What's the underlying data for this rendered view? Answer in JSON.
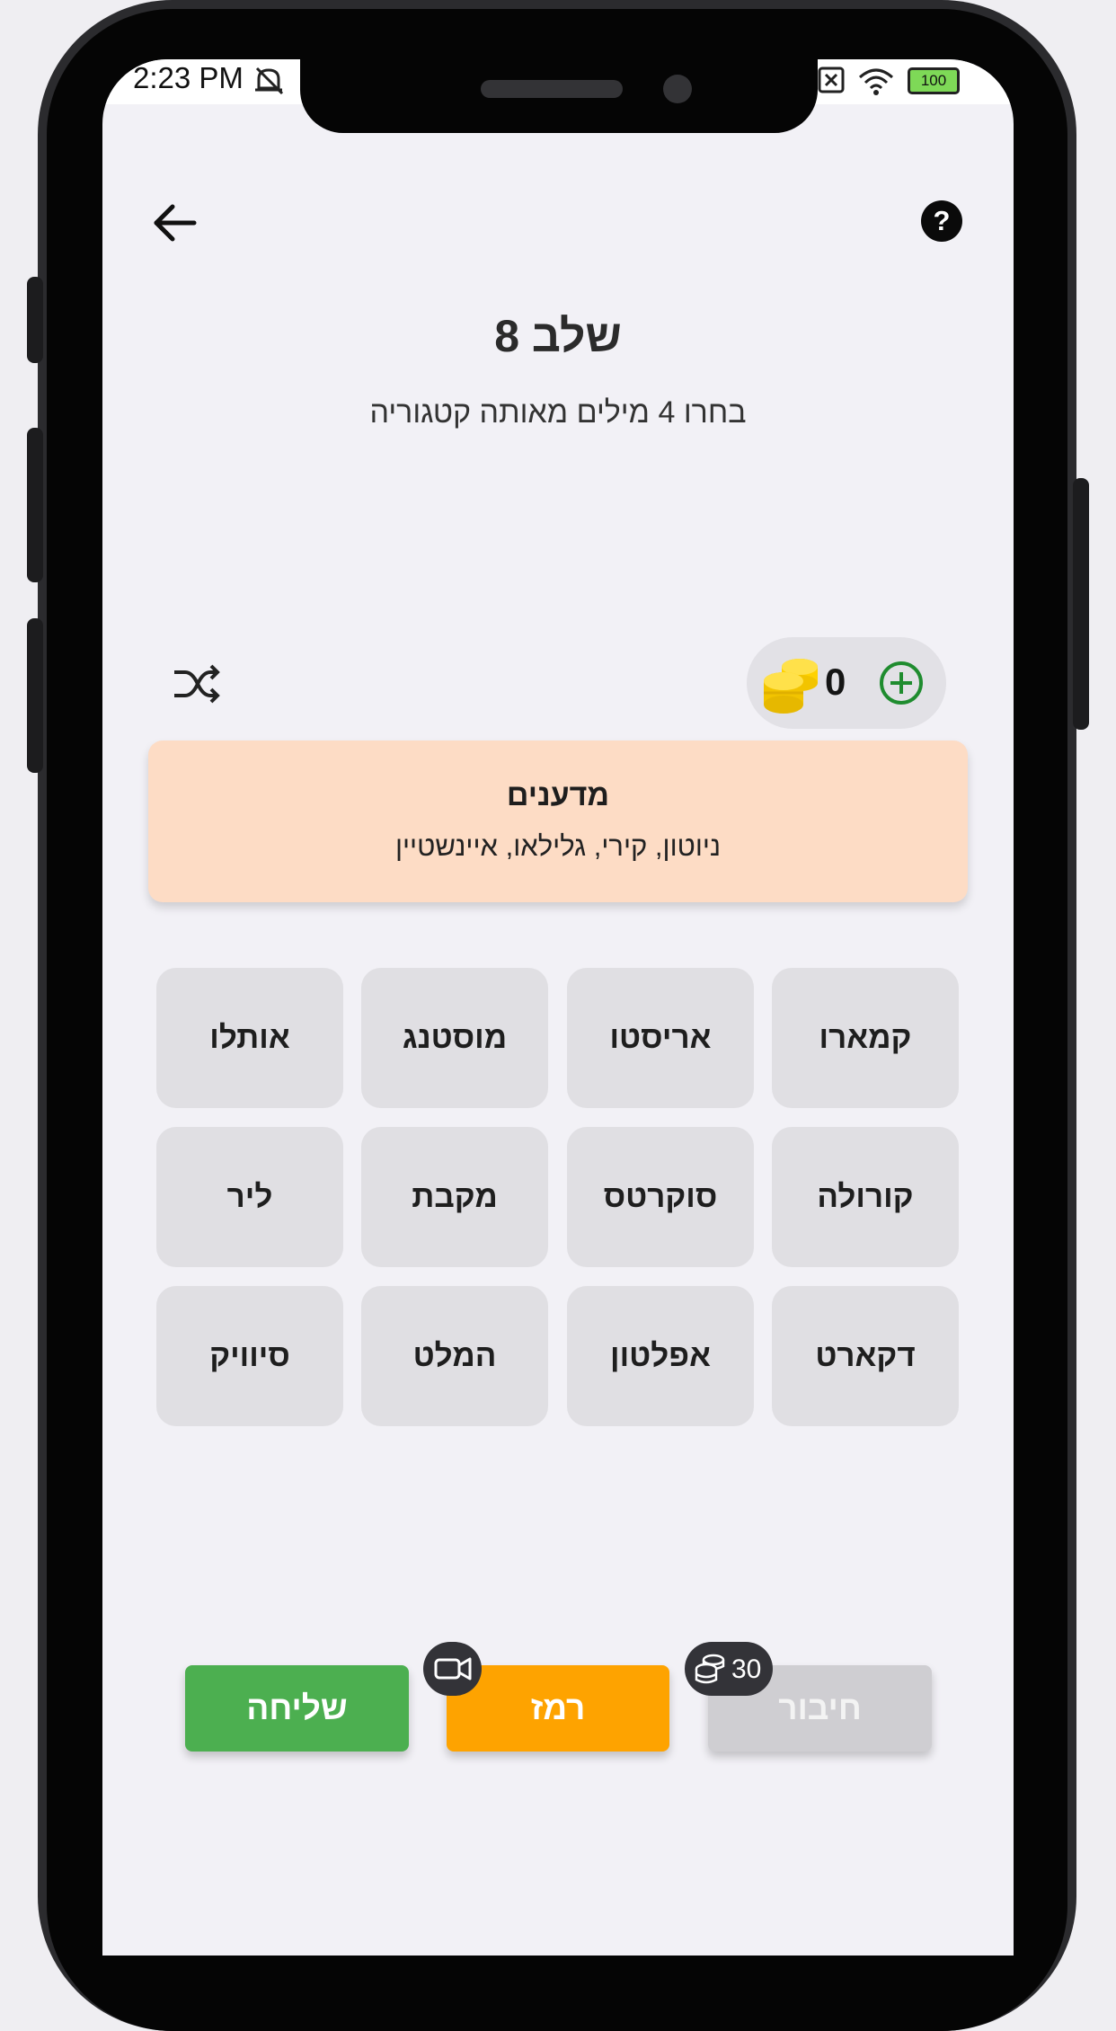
{
  "status_bar": {
    "time": "2:23 PM",
    "battery": "100"
  },
  "header": {
    "back_icon": "arrow-left-icon",
    "help_label": "?",
    "title": "שלב 8",
    "subtitle": "בחרו 4 מילים מאותה קטגוריה"
  },
  "toolbar": {
    "shuffle_icon": "shuffle-icon",
    "coin_icon": "coin-stack-icon",
    "coins": "0",
    "add_icon": "plus-circle-icon"
  },
  "solved_category": {
    "name": "מדענים",
    "words": "ניוטון, קירי, גלילאו, איינשטיין",
    "color": "#fddcc5"
  },
  "tiles": [
    [
      "קמארו",
      "אריסטו",
      "מוסטנג",
      "אותלו"
    ],
    [
      "קורולה",
      "סוקרטס",
      "מקבת",
      "ליר"
    ],
    [
      "דקארט",
      "אפלטון",
      "המלט",
      "סיוויק"
    ]
  ],
  "actions": {
    "send": "שליחה",
    "hint": "רמז",
    "connect": "חיבור",
    "hint_badge_icon": "video-camera-icon",
    "connect_cost": "30",
    "send_color": "#4caf50",
    "hint_color": "#fea300",
    "connect_color": "#cfced2"
  }
}
